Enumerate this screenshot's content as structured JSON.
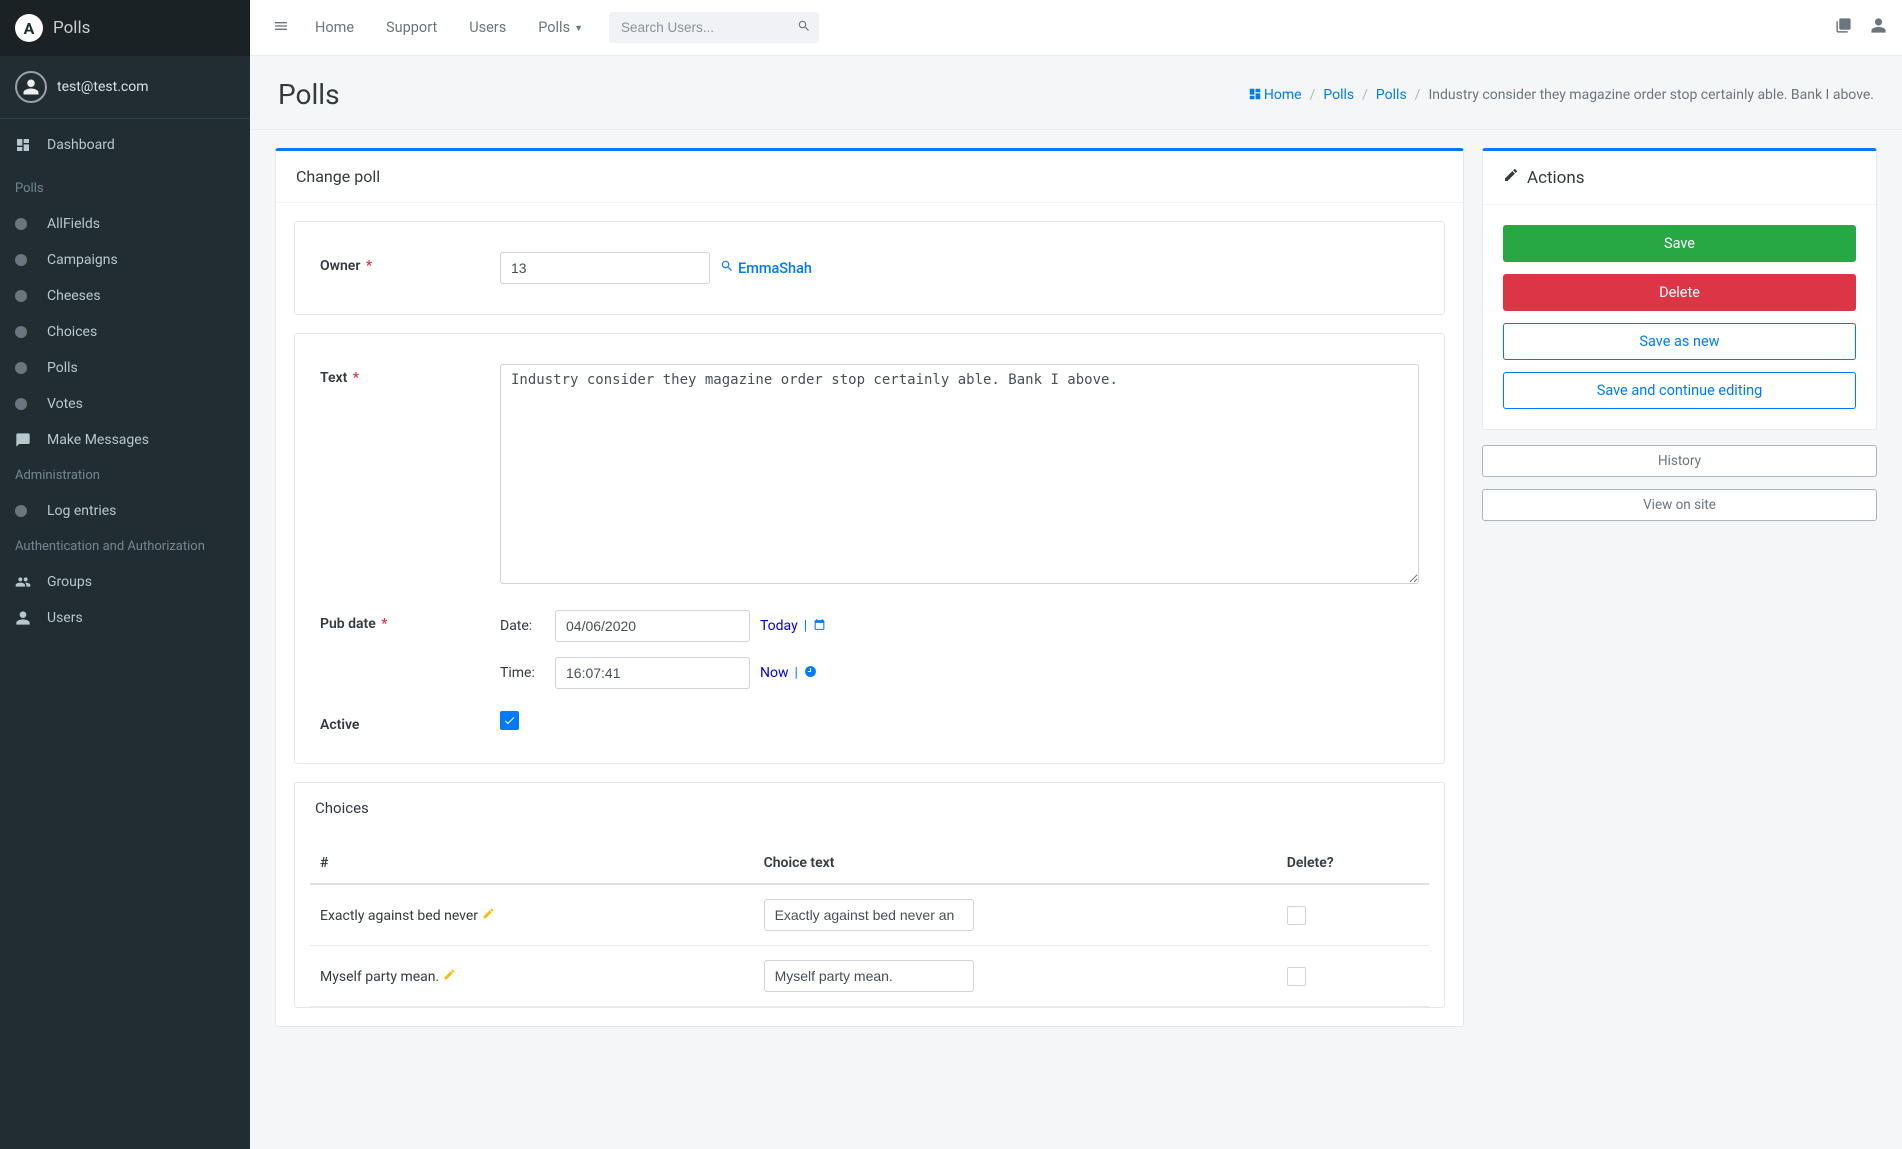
{
  "brand": {
    "name": "Polls"
  },
  "user": {
    "email": "test@test.com"
  },
  "sidebar": {
    "top_items": [
      {
        "label": "Dashboard",
        "icon": "dashboard"
      }
    ],
    "sections": [
      {
        "title": "Polls",
        "items": [
          {
            "label": "AllFields"
          },
          {
            "label": "Campaigns"
          },
          {
            "label": "Cheeses"
          },
          {
            "label": "Choices"
          },
          {
            "label": "Polls"
          },
          {
            "label": "Votes"
          },
          {
            "label": "Make Messages",
            "icon": "comments"
          }
        ]
      },
      {
        "title": "Administration",
        "items": [
          {
            "label": "Log entries"
          }
        ]
      },
      {
        "title": "Authentication and Authorization",
        "items": [
          {
            "label": "Groups",
            "icon": "users"
          },
          {
            "label": "Users",
            "icon": "user"
          }
        ]
      }
    ]
  },
  "topnav": {
    "links": [
      {
        "label": "Home"
      },
      {
        "label": "Support"
      },
      {
        "label": "Users"
      },
      {
        "label": "Polls",
        "dropdown": true
      }
    ],
    "search_placeholder": "Search Users..."
  },
  "page": {
    "title": "Polls",
    "breadcrumb": {
      "home": "Home",
      "items": [
        "Polls",
        "Polls"
      ],
      "active": "Industry consider they magazine order stop certainly able. Bank I above."
    }
  },
  "form": {
    "header": "Change poll",
    "owner": {
      "label": "Owner",
      "value": "13",
      "link_text": "EmmaShah"
    },
    "text": {
      "label": "Text",
      "value": "Industry consider they magazine order stop certainly able. Bank I above."
    },
    "pub_date": {
      "label": "Pub date",
      "date_label": "Date:",
      "date_value": "04/06/2020",
      "today": "Today",
      "time_label": "Time:",
      "time_value": "16:07:41",
      "now": "Now"
    },
    "active": {
      "label": "Active",
      "checked": true
    }
  },
  "choices": {
    "header": "Choices",
    "columns": {
      "num": "#",
      "text": "Choice text",
      "del": "Delete?"
    },
    "rows": [
      {
        "label": "Exactly against bed never",
        "input": "Exactly against bed never an"
      },
      {
        "label": "Myself party mean.",
        "input": "Myself party mean."
      }
    ]
  },
  "actions": {
    "header": "Actions",
    "save": "Save",
    "delete": "Delete",
    "save_as_new": "Save as new",
    "save_continue": "Save and continue editing",
    "history": "History",
    "view_on_site": "View on site"
  }
}
